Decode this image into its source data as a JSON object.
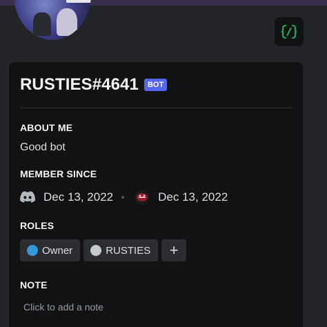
{
  "profile": {
    "username": "RUSTIES#4641",
    "bot_tag": "BOT",
    "about_me_title": "ABOUT ME",
    "about_me_text": "Good bot",
    "member_since_title": "MEMBER SINCE",
    "discord_member_since": "Dec 13, 2022",
    "server_member_since": "Dec 13, 2022",
    "roles_title": "ROLES",
    "roles": [
      {
        "name": "Owner",
        "color": "#3498db"
      },
      {
        "name": "RUSTIES",
        "color": "#c4c9ce"
      }
    ],
    "add_role_label": "+",
    "note_title": "NOTE",
    "note_placeholder": "Click to add a note"
  },
  "icons": {
    "developer_badge": "supports-slash-commands-icon",
    "discord": "discord-logo-icon",
    "server": "server-icon"
  },
  "colors": {
    "accent": "#5865f2",
    "card_bg": "#111214",
    "page_bg": "#232428",
    "badge_green": "#23a55a"
  }
}
